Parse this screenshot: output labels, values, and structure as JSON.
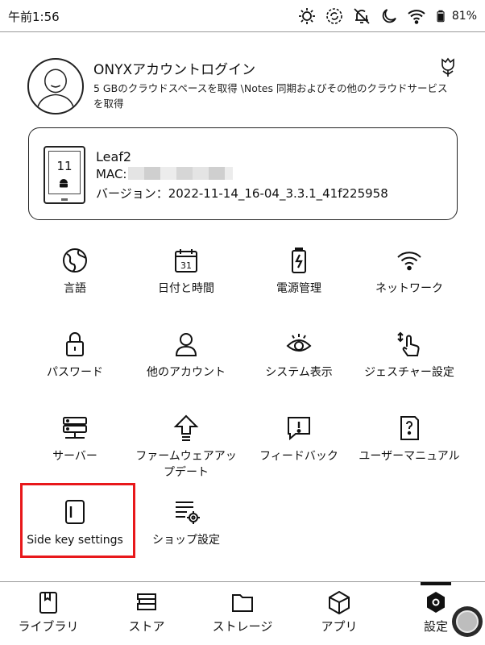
{
  "status_bar": {
    "time": "午前1:56",
    "battery": "81%",
    "icons": [
      "brightness-icon",
      "refresh-icon",
      "bell-off-icon",
      "moon-icon",
      "wifi-icon",
      "battery-icon"
    ]
  },
  "account": {
    "title": "ONYXアカウントログイン",
    "description": "5 GBのクラウドスペースを取得 \\Notes 同期およびその他のクラウドサービスを取得"
  },
  "device": {
    "screen_number": "11",
    "name": "Leaf2",
    "mac_label": "MAC:",
    "version": "バージョン：2022-11-14_16-04_3.3.1_41f225958"
  },
  "settings": [
    {
      "label": "言語",
      "icon": "globe-icon"
    },
    {
      "label": "日付と時間",
      "icon": "calendar-icon"
    },
    {
      "label": "電源管理",
      "icon": "battery-charge-icon"
    },
    {
      "label": "ネットワーク",
      "icon": "wifi-icon"
    },
    {
      "label": "パスワード",
      "icon": "lock-icon"
    },
    {
      "label": "他のアカウント",
      "icon": "user-icon"
    },
    {
      "label": "システム表示",
      "icon": "eye-icon"
    },
    {
      "label": "ジェスチャー設定",
      "icon": "gesture-hand-icon"
    },
    {
      "label": "サーバー",
      "icon": "server-icon"
    },
    {
      "label": "ファームウェアアップデート",
      "icon": "upload-arrow-icon"
    },
    {
      "label": "フィードバック",
      "icon": "feedback-icon"
    },
    {
      "label": "ユーザーマニュアル",
      "icon": "manual-icon"
    },
    {
      "label": "Side key settings",
      "icon": "side-key-icon"
    },
    {
      "label": "ショップ設定",
      "icon": "shop-settings-icon"
    }
  ],
  "calendar_day": "31",
  "nav": [
    {
      "label": "ライブラリ",
      "icon": "library-icon"
    },
    {
      "label": "ストア",
      "icon": "store-icon"
    },
    {
      "label": "ストレージ",
      "icon": "folder-icon"
    },
    {
      "label": "アプリ",
      "icon": "apps-icon"
    },
    {
      "label": "設定",
      "icon": "settings-icon"
    }
  ],
  "colors": {
    "highlight": "#e8181b",
    "text": "#111111",
    "divider": "#9a9a9a"
  }
}
